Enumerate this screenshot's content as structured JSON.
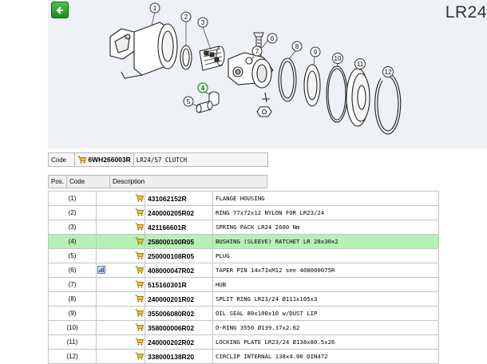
{
  "model": "LR24",
  "diagram": {
    "callouts": [
      "1",
      "2",
      "3",
      "4",
      "5",
      "6",
      "7",
      "8",
      "9",
      "10",
      "11",
      "12"
    ],
    "highlighted_callout": "4"
  },
  "header": {
    "code_label": "Code",
    "code_value": "6WH266003R",
    "code_desc": "LR24/S7 CLUTCH"
  },
  "columns": {
    "pos": "Pos.",
    "code": "Code",
    "description": "Description"
  },
  "parts": [
    {
      "pos": "(1)",
      "code": "431062152R",
      "desc": "FLANGE HOUSING",
      "selected": false,
      "info": false
    },
    {
      "pos": "(2)",
      "code": "240000205R02",
      "desc": "RING 77x72x12 NYLON FOR LR23/24",
      "selected": false,
      "info": false
    },
    {
      "pos": "(3)",
      "code": "421166601R",
      "desc": "SPRING PACK LR24 2600 Nm",
      "selected": false,
      "info": false
    },
    {
      "pos": "(4)",
      "code": "258000100R05",
      "desc": "BUSHING (SLEEVE) RATCHET LR 28x30x2",
      "selected": true,
      "info": false
    },
    {
      "pos": "(5)",
      "code": "250000108R05",
      "desc": "PLUG",
      "selected": false,
      "info": false
    },
    {
      "pos": "(6)",
      "code": "408000047R02",
      "desc": "TAPER PIN 14x73xM12 see 408000075R",
      "selected": false,
      "info": true
    },
    {
      "pos": "(7)",
      "code": "515160301R",
      "desc": "HUB",
      "selected": false,
      "info": false
    },
    {
      "pos": "(8)",
      "code": "240000201R02",
      "desc": "SPLIT RING LR23/24 Ø111x105x3",
      "selected": false,
      "info": false
    },
    {
      "pos": "(9)",
      "code": "355006080R02",
      "desc": "OIL SEAL 80x100x10 w/DUST LIP",
      "selected": false,
      "info": false
    },
    {
      "pos": "(10)",
      "code": "358000006R02",
      "desc": "O-RING 3550 Ø139.37x2.62",
      "selected": false,
      "info": false
    },
    {
      "pos": "(11)",
      "code": "240000202R02",
      "desc": "LOCKING PLATE LR23/24 Ø138x80.5x26",
      "selected": false,
      "info": false
    },
    {
      "pos": "(12)",
      "code": "338000138R20",
      "desc": "CIRCLIP INTERNAL 138x4.00 DIN472",
      "selected": false,
      "info": false
    }
  ],
  "colors": {
    "selected_row": "#b7f0b7",
    "callout_highlight": "#2a9a2a",
    "cart": "#d8a000"
  },
  "icons": {
    "back": "back-arrow-icon",
    "cart": "cart-icon",
    "info": "info-icon"
  }
}
